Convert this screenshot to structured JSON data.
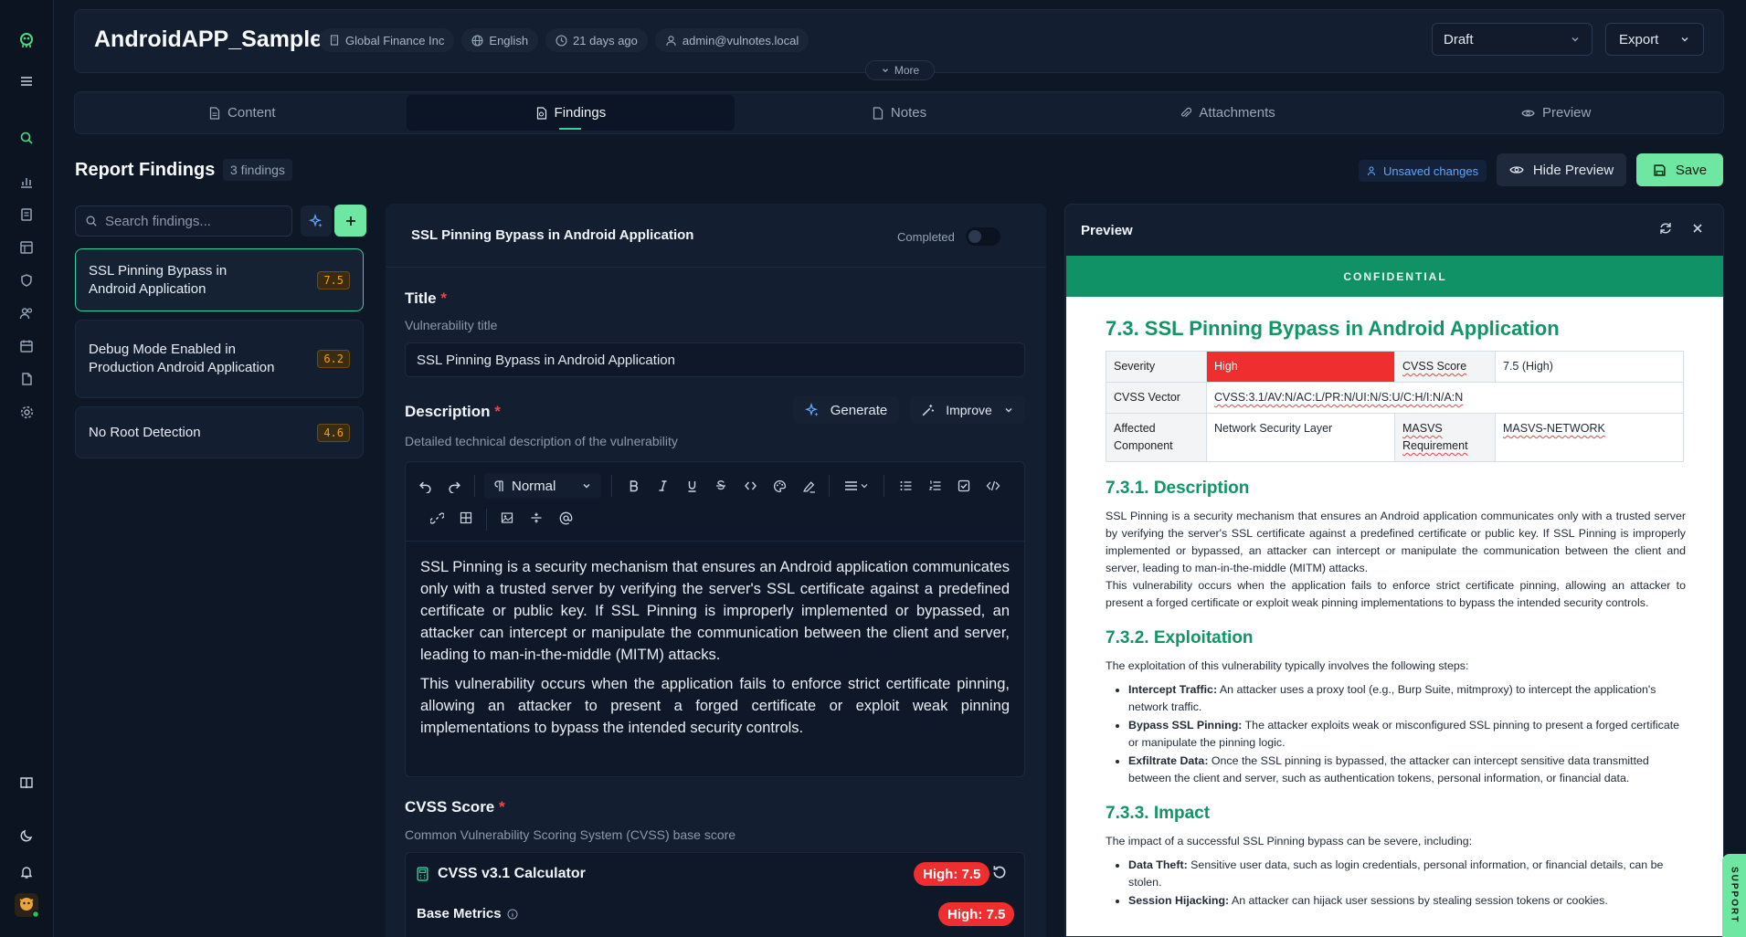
{
  "app": {
    "title": "AndroidAPP_Sample",
    "chips": [
      "Global Finance Inc",
      "English",
      "21 days ago",
      "admin@vulnotes.local"
    ],
    "status": "Draft",
    "export_label": "Export",
    "more_label": "More"
  },
  "tabs": [
    "Content",
    "Findings",
    "Notes",
    "Attachments",
    "Preview"
  ],
  "page": {
    "title": "Report Findings",
    "count": "3 findings",
    "unsaved": "Unsaved changes",
    "hide_preview": "Hide Preview",
    "save": "Save"
  },
  "findings": {
    "search_placeholder": "Search findings...",
    "items": [
      {
        "title": "SSL Pinning Bypass in Android Application",
        "score": "7.5"
      },
      {
        "title": "Debug Mode Enabled in Production Android Application",
        "score": "6.2"
      },
      {
        "title": "No Root Detection",
        "score": "4.6"
      }
    ]
  },
  "editor": {
    "header_title": "SSL Pinning Bypass in Android Application",
    "completed_label": "Completed",
    "title_label": "Title",
    "title_help": "Vulnerability title",
    "title_value": "SSL Pinning Bypass in Android Application",
    "desc_label": "Description",
    "desc_help": "Detailed technical description of the vulnerability",
    "generate": "Generate",
    "improve": "Improve",
    "format": "Normal",
    "desc_p1": "SSL Pinning is a security mechanism that ensures an Android application communicates only with a trusted server by verifying the server's SSL certificate against a predefined certificate or public key. If SSL Pinning is improperly implemented or bypassed, an attacker can intercept or manipulate the communication between the client and server, leading to man-in-the-middle (MITM) attacks.",
    "desc_p2": "This vulnerability occurs when the application fails to enforce strict certificate pinning, allowing an attacker to present a forged certificate or exploit weak pinning implementations to bypass the intended security controls.",
    "cvss_label": "CVSS Score",
    "cvss_help": "Common Vulnerability Scoring System (CVSS) base score",
    "calc_title": "CVSS v3.1 Calculator",
    "high_pill": "High: 7.5",
    "base_metrics": "Base Metrics"
  },
  "preview": {
    "title": "Preview",
    "confidential": "CONFIDENTIAL",
    "heading": "7.3. SSL Pinning Bypass in Android Application",
    "table": {
      "severity_l": "Severity",
      "severity_v": "High",
      "cvss_l": "CVSS Score",
      "cvss_v": "7.5 (High)",
      "vector_l": "CVSS Vector",
      "vector_v": "CVSS:3.1/AV:N/AC:L/PR:N/UI:N/S:U/C:H/I:N/A:N",
      "comp_l": "Affected Component",
      "comp_v": "Network Security Layer",
      "masvs_l": "MASVS Requirement",
      "masvs_v": "MASVS-NETWORK"
    },
    "h_desc": "7.3.1. Description",
    "desc_p1": "SSL Pinning is a security mechanism that ensures an Android application communicates only with a trusted server by verifying the server's SSL certificate against a predefined certificate or public key. If SSL Pinning is improperly implemented or bypassed, an attacker can intercept or manipulate the communication between the client and server, leading to man-in-the-middle (MITM) attacks.",
    "desc_p2": "This vulnerability occurs when the application fails to enforce strict certificate pinning, allowing an attacker to present a forged certificate or exploit weak pinning implementations to bypass the intended security controls.",
    "h_expl": "7.3.2. Exploitation",
    "expl_intro": "The exploitation of this vulnerability typically involves the following steps:",
    "expl_items": [
      {
        "b": "Intercept Traffic:",
        "t": " An attacker uses a proxy tool (e.g., Burp Suite, mitmproxy) to intercept the application's network traffic."
      },
      {
        "b": "Bypass SSL Pinning:",
        "t": " The attacker exploits weak or misconfigured SSL pinning to present a forged certificate or manipulate the pinning logic."
      },
      {
        "b": "Exfiltrate Data:",
        "t": " Once the SSL pinning is bypassed, the attacker can intercept sensitive data transmitted between the client and server, such as authentication tokens, personal information, or financial data."
      }
    ],
    "h_impact": "7.3.3. Impact",
    "impact_intro": "The impact of a successful SSL Pinning bypass can be severe, including:",
    "impact_items": [
      {
        "b": "Data Theft:",
        "t": " Sensitive user data, such as login credentials, personal information, or financial details, can be stolen."
      },
      {
        "b": "Session Hijacking:",
        "t": " An attacker can hijack user sessions by stealing session tokens or cookies."
      }
    ]
  },
  "support_label": "SUPPORT",
  "colors": {
    "accent": "#34d399",
    "save": "#6ee7a2",
    "high": "#ef2f2f",
    "doc_green": "#109566"
  }
}
